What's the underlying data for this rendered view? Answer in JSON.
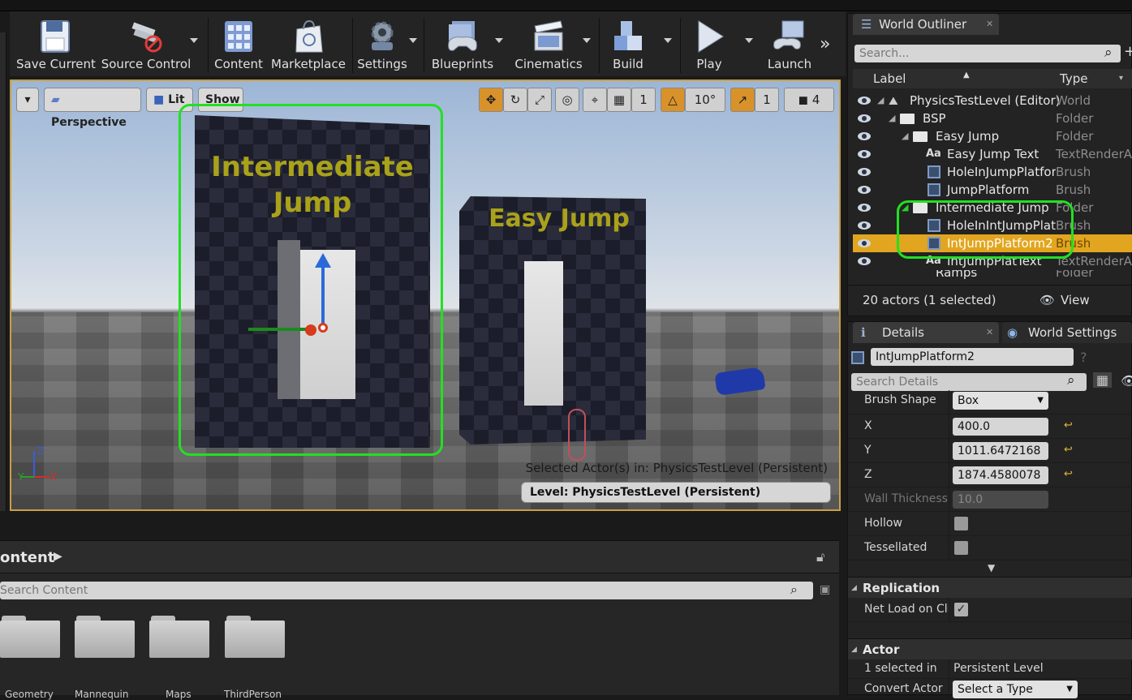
{
  "toolbar": {
    "save_current": "Save Current",
    "source_control": "Source Control",
    "content": "Content",
    "marketplace": "Marketplace",
    "settings": "Settings",
    "blueprints": "Blueprints",
    "cinematics": "Cinematics",
    "build": "Build",
    "play": "Play",
    "launch": "Launch"
  },
  "viewport": {
    "perspective": "Perspective",
    "lit": "Lit",
    "show": "Show",
    "translate_snap": "1",
    "rotation_snap": "10°",
    "scale_snap": "1",
    "camera_speed": "4",
    "block_intermediate_line1": "Intermediate",
    "block_intermediate_line2": "Jump",
    "block_easy": "Easy Jump",
    "selected_actors": "Selected Actor(s) in:  PhysicsTestLevel (Persistent)",
    "level": "Level:  PhysicsTestLevel (Persistent)",
    "accent_color": "#d9922a",
    "highlight_color": "#22e022"
  },
  "content_browser": {
    "title": "ontent",
    "search_placeholder": "Search Content",
    "folders": [
      "Geometry",
      "Mannequin",
      "Maps",
      "ThirdPerson"
    ]
  },
  "outliner": {
    "tab": "World Outliner",
    "search_placeholder": "Search...",
    "col_label": "Label",
    "col_type": "Type",
    "rows": [
      {
        "name": "PhysicsTestLevel (Editor)",
        "type": "World"
      },
      {
        "name": "BSP",
        "type": "Folder"
      },
      {
        "name": "Easy Jump",
        "type": "Folder"
      },
      {
        "name": "Easy Jump Text",
        "type": "TextRenderAc"
      },
      {
        "name": "HoleInJumpPlatform",
        "type": "Brush"
      },
      {
        "name": "JumpPlatform",
        "type": "Brush"
      },
      {
        "name": "Intermediate Jump",
        "type": "Folder"
      },
      {
        "name": "HoleInIntJumpPlatf",
        "type": "Brush"
      },
      {
        "name": "IntJumpPlatform2",
        "type": "Brush"
      },
      {
        "name": "IntJumpPlatText",
        "type": "TextRenderAc"
      },
      {
        "name": "Ramps",
        "type": "Folder"
      }
    ],
    "actor_count": "20 actors (1 selected)",
    "view_options": "View Options"
  },
  "details": {
    "tab": "Details",
    "tab2": "World Settings",
    "name": "IntJumpPlatform2",
    "search_placeholder": "Search Details",
    "brush_shape_label": "Brush Shape",
    "brush_shape_value": "Box",
    "x_label": "X",
    "x_value": "400.0",
    "y_label": "Y",
    "y_value": "1011.6472168",
    "z_label": "Z",
    "z_value": "1874.4580078",
    "wall_label": "Wall Thickness",
    "wall_value": "10.0",
    "hollow_label": "Hollow",
    "tess_label": "Tessellated",
    "replication": "Replication",
    "net_load": "Net Load on Clie",
    "actor": "Actor",
    "selected_in_label": "1 selected in",
    "selected_in_value": "Persistent Level",
    "convert_label": "Convert Actor",
    "convert_value": "Select a Type"
  }
}
